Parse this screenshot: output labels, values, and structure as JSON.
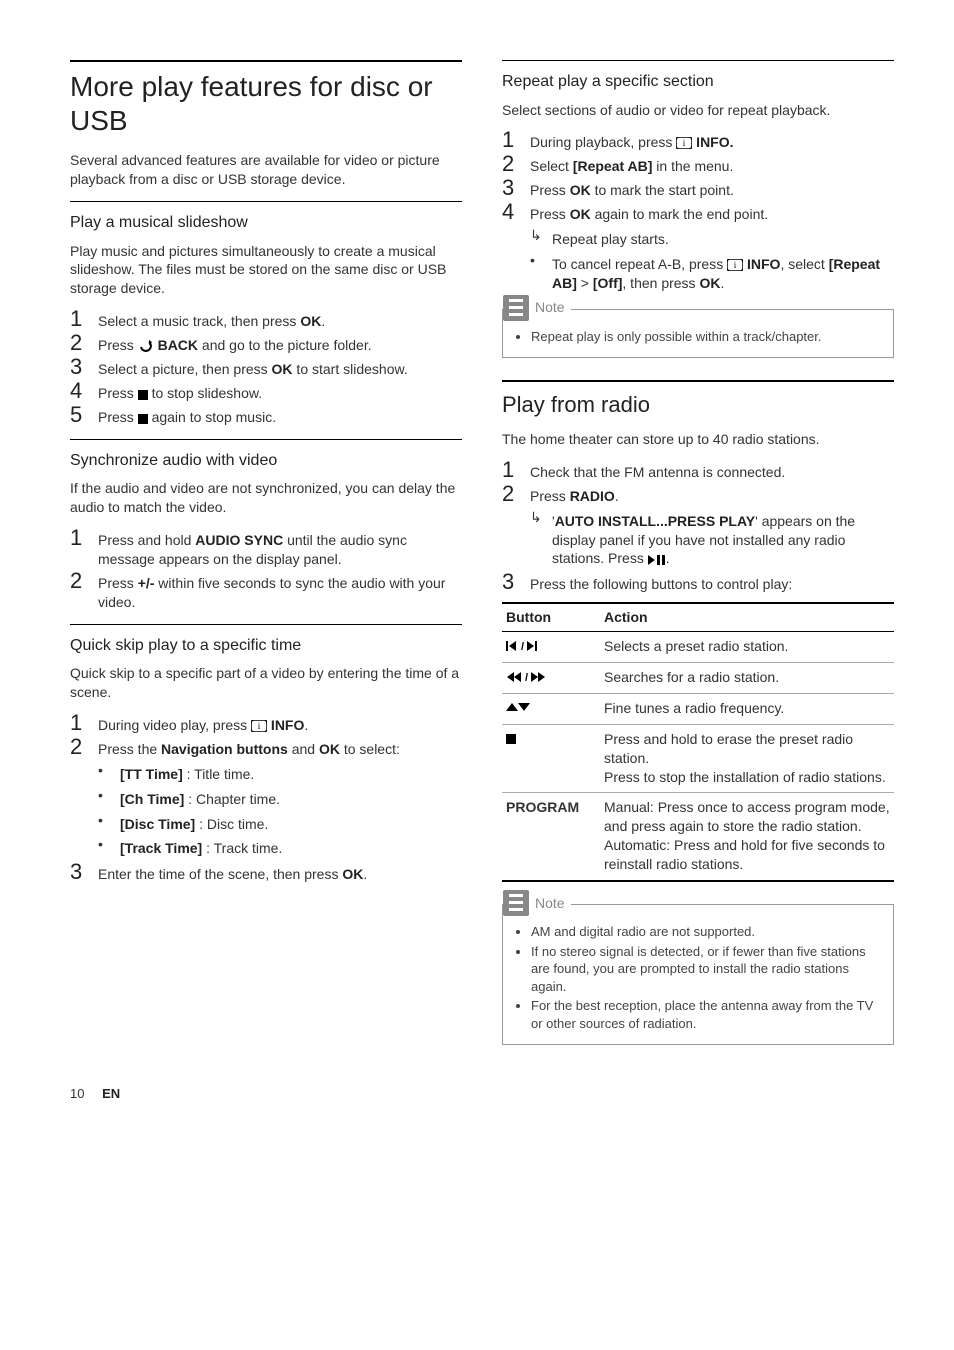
{
  "left": {
    "title": "More play features for disc or USB",
    "intro": "Several advanced features are available for video or picture playback from a disc or USB storage device.",
    "sec1": {
      "heading": "Play a musical slideshow",
      "intro": "Play music and pictures simultaneously to create a musical slideshow. The files must be stored on the same disc or USB storage device.",
      "s1a": "Select a music track, then press ",
      "s1b": "OK",
      "s1c": ".",
      "s2a": "Press ",
      "s2b": " BACK",
      "s2c": " and go to the picture folder.",
      "s3a": "Select a picture, then press ",
      "s3b": "OK",
      "s3c": " to start slideshow.",
      "s4a": "Press ",
      "s4b": " to stop slideshow.",
      "s5a": "Press ",
      "s5b": " again to stop music."
    },
    "sec2": {
      "heading": "Synchronize audio with video",
      "intro": "If the audio and video are not synchronized, you can delay the audio to match the video.",
      "s1a": "Press and hold ",
      "s1b": "AUDIO SYNC",
      "s1c": " until the audio sync message appears on the display panel.",
      "s2a": "Press ",
      "s2b": "+/-",
      "s2c": " within five seconds to sync the audio with your video."
    },
    "sec3": {
      "heading": "Quick skip play to a specific time",
      "intro": "Quick skip to a specific part of a video by entering the time of a scene.",
      "s1a": "During video play, press ",
      "s1b": " INFO",
      "s1c": ".",
      "s2a": "Press the ",
      "s2b": "Navigation buttons",
      "s2c": " and ",
      "s2d": "OK",
      "s2e": " to select:",
      "b1a": "[TT Time]",
      "b1b": " : Title time.",
      "b2a": "[Ch Time]",
      "b2b": " : Chapter time.",
      "b3a": "[Disc Time]",
      "b3b": " : Disc time.",
      "b4a": "[Track Time]",
      "b4b": " : Track time.",
      "s3a": "Enter the time of the scene, then press ",
      "s3b": "OK",
      "s3c": "."
    }
  },
  "right": {
    "sec4": {
      "heading": "Repeat play a specific section",
      "intro": "Select sections of audio or video for repeat playback.",
      "s1a": "During playback, press ",
      "s1b": " INFO.",
      "s2a": "Select ",
      "s2b": "[Repeat AB]",
      "s2c": " in the menu.",
      "s3a": "Press ",
      "s3b": "OK",
      "s3c": " to mark the start point.",
      "s4a": "Press ",
      "s4b": "OK",
      "s4c": " again to mark the end point.",
      "sub1": "Repeat play starts.",
      "sub2a": "To cancel repeat A-B, press ",
      "sub2b": " INFO",
      "sub2c": ", select ",
      "sub2d": "[Repeat AB]",
      "sub2e": " > ",
      "sub2f": "[Off]",
      "sub2g": ", then press ",
      "sub2h": "OK",
      "sub2i": "."
    },
    "note1": {
      "label": "Note",
      "text": "Repeat play is only possible within a track/chapter."
    },
    "radio": {
      "title": "Play from radio",
      "intro": "The home theater can store up to 40 radio stations.",
      "s1": "Check that the FM antenna is connected.",
      "s2a": "Press ",
      "s2b": "RADIO",
      "s2c": ".",
      "sub1a": "'",
      "sub1b": "AUTO INSTALL...PRESS PLAY",
      "sub1c": "' appears on the display panel if you have not installed any radio stations. Press ",
      "sub1d": ".",
      "s3": "Press the following buttons to control play:",
      "th1": "Button",
      "th2": "Action",
      "r1": "Selects a preset radio station.",
      "r2": "Searches for a radio station.",
      "r3": "Fine tunes a radio frequency.",
      "r4": "Press and hold to erase the preset radio station.\nPress to stop the installation of radio stations.",
      "r5l": "PROGRAM",
      "r5": "Manual: Press once to access program mode, and press again to store the radio station.\nAutomatic: Press and hold for five seconds to reinstall radio stations."
    },
    "note2": {
      "label": "Note",
      "b1": "AM and digital radio are not supported.",
      "b2": "If no stereo signal is detected, or if fewer than five stations are found, you are prompted to install the radio stations again.",
      "b3": "For the best reception, place the antenna away from the TV or other sources of radiation."
    }
  },
  "footer": {
    "page": "10",
    "lang": "EN"
  }
}
